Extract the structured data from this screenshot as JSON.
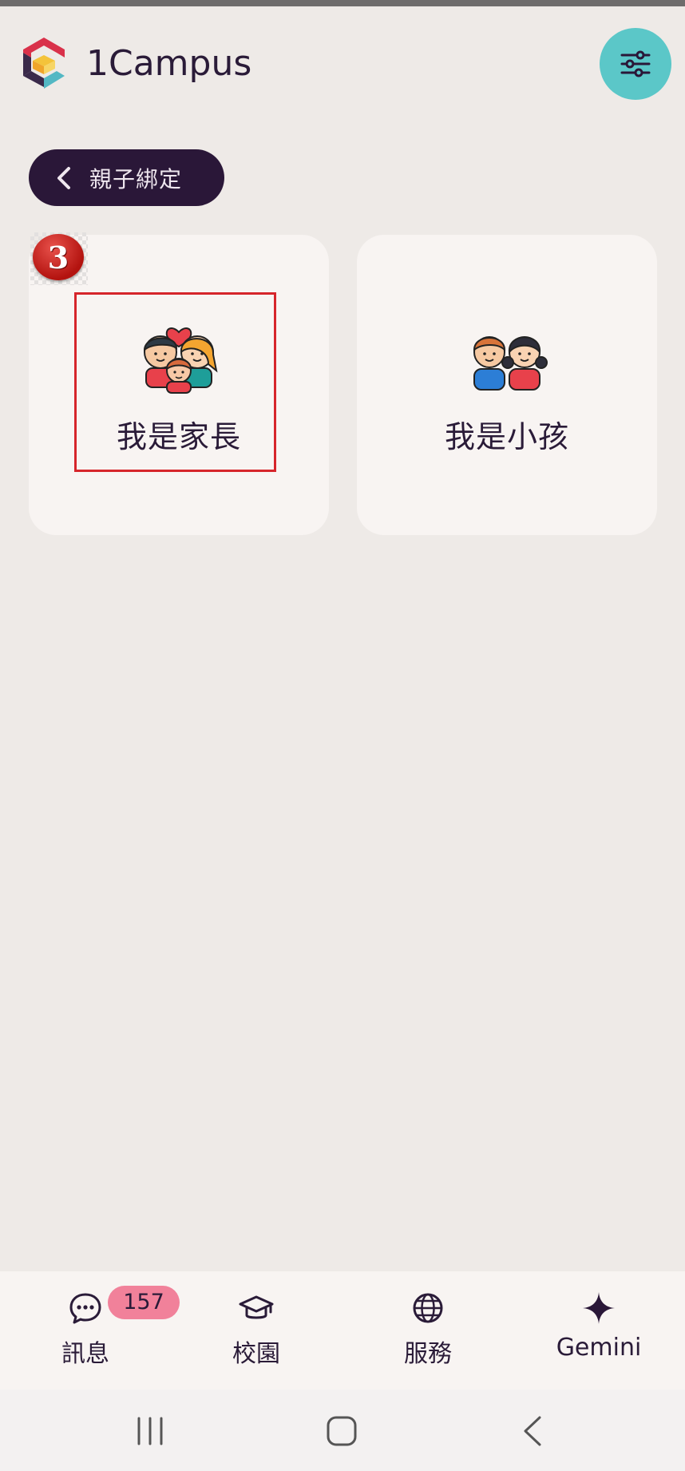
{
  "header": {
    "app_title": "1Campus",
    "filter_icon": "sliders-icon"
  },
  "back_button": {
    "label": "親子綁定"
  },
  "cards": [
    {
      "label": "我是家長",
      "icon": "family-icon",
      "highlighted": true,
      "step_number": "3"
    },
    {
      "label": "我是小孩",
      "icon": "children-icon",
      "highlighted": false
    }
  ],
  "bottom_nav": {
    "items": [
      {
        "label": "訊息",
        "icon": "chat-bubble-icon",
        "badge": "157"
      },
      {
        "label": "校園",
        "icon": "graduation-cap-icon"
      },
      {
        "label": "服務",
        "icon": "globe-icon"
      },
      {
        "label": "Gemini",
        "icon": "sparkle-icon"
      }
    ]
  },
  "system_nav": [
    "recent-apps-icon",
    "home-icon",
    "back-icon"
  ],
  "colors": {
    "background": "#EEEAE7",
    "card": "#F8F4F2",
    "dark_purple": "#2A1738",
    "teal": "#5BC7C8",
    "highlight_red": "#D6252B",
    "badge_pink": "#F1819A"
  }
}
